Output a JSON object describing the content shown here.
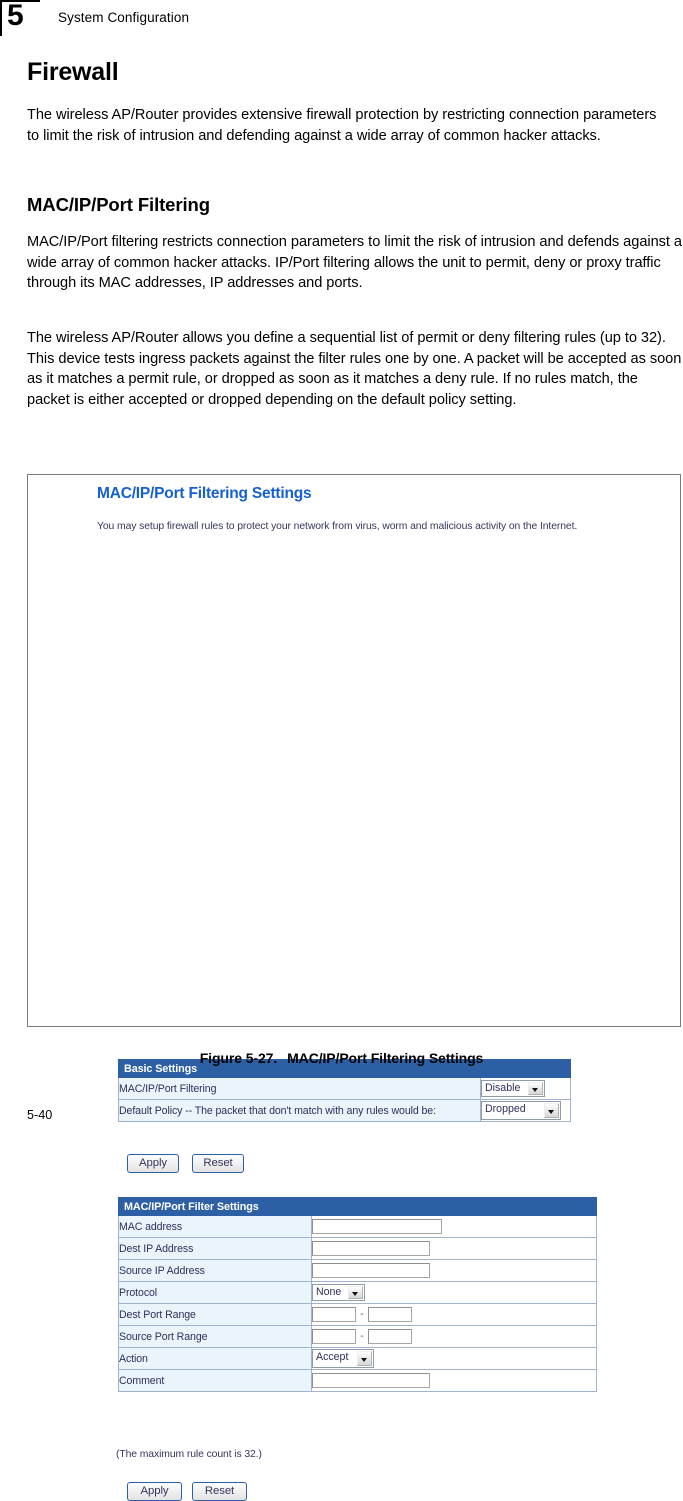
{
  "header": {
    "chapter_number": "5",
    "title": "System Configuration"
  },
  "sections": {
    "h1": "Firewall",
    "intro": "The wireless AP/Router provides extensive firewall protection by restricting connection parameters to limit the risk of intrusion and defending against a wide array of common hacker attacks.",
    "h2": "MAC/IP/Port Filtering",
    "para1": "MAC/IP/Port filtering restricts connection parameters to limit the risk of intrusion and defends against a wide array of common hacker attacks. IP/Port filtering allows the unit to permit, deny or proxy traffic through its MAC addresses, IP addresses and ports.",
    "para2": "The wireless AP/Router allows you define a sequential list of permit or deny filtering rules (up to 32). This device tests ingress packets against the filter rules one by one. A packet will be accepted as soon as it matches a permit rule, or dropped as soon as it matches a deny rule. If no rules match, the packet is either accepted or dropped depending on the default policy setting."
  },
  "screenshot": {
    "title": "MAC/IP/Port Filtering Settings",
    "description": "You may setup firewall rules to protect your network from virus, worm and malicious activity on the Internet.",
    "basic_settings": {
      "heading": "Basic Settings",
      "rows": [
        {
          "label": "MAC/IP/Port Filtering",
          "control": "select",
          "value": "Disable"
        },
        {
          "label": "Default Policy -- The packet that don't match with any rules would be:",
          "control": "select",
          "value": "Dropped"
        }
      ],
      "apply_label": "Apply",
      "reset_label": "Reset"
    },
    "filter_settings": {
      "heading": "MAC/IP/Port Filter Settings",
      "rows": [
        {
          "label": "MAC address",
          "control": "text",
          "value": ""
        },
        {
          "label": "Dest IP Address",
          "control": "text",
          "value": ""
        },
        {
          "label": "Source IP Address",
          "control": "text",
          "value": ""
        },
        {
          "label": "Protocol",
          "control": "select",
          "value": "None"
        },
        {
          "label": "Dest Port Range",
          "control": "range",
          "from": "",
          "to": "",
          "separator": "-"
        },
        {
          "label": "Source Port Range",
          "control": "range",
          "from": "",
          "to": "",
          "separator": "-"
        },
        {
          "label": "Action",
          "control": "select",
          "value": "Accept"
        },
        {
          "label": "Comment",
          "control": "text",
          "value": ""
        }
      ],
      "note": "(The maximum rule count is 32.)",
      "apply_label": "Apply",
      "reset_label": "Reset"
    },
    "colors": {
      "heading_bar": "#2d5fa5",
      "title_blue": "#1560d0",
      "label_cell": "#e9f4fb",
      "text_navy": "#30305c"
    }
  },
  "caption": {
    "figure_number": "Figure 5-27.",
    "figure_title": "MAC/IP/Port Filtering Settings"
  },
  "folio": "5-40"
}
